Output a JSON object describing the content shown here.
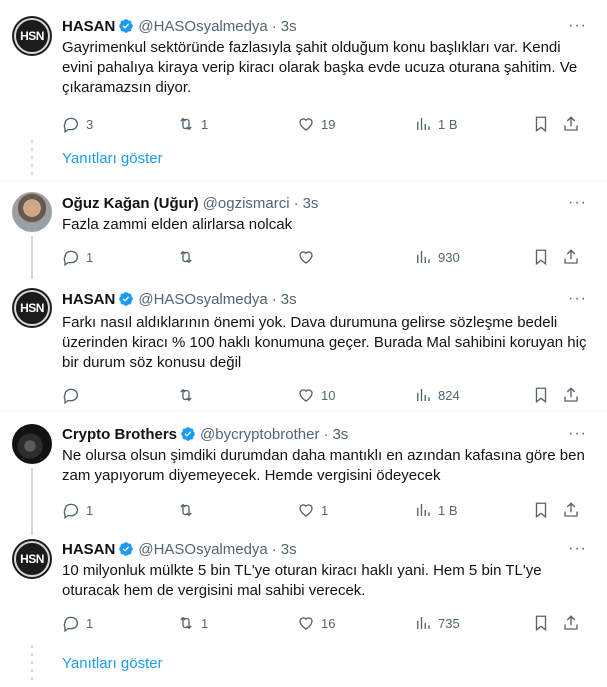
{
  "labels": {
    "show_replies": "Yanıtları göster"
  },
  "colors": {
    "link": "#1d9bf0",
    "verified": "#1d9bf0",
    "text": "#0f1419",
    "muted": "#536471"
  },
  "tweets": [
    {
      "name": "HASAN",
      "verified": true,
      "handle": "@HASOsyalmedya",
      "time": "3s",
      "avatar": "HSN",
      "text": "Gayrimenkul sektöründe fazlasıyla şahit olduğum konu başlıkları var. Kendi evini pahalıya kiraya verip kiracı olarak başka evde ucuza oturana şahitim. Ve çıkaramazsın diyor.",
      "replies": "3",
      "retweets": "1",
      "likes": "19",
      "views": "1 B"
    },
    {
      "name": "Oğuz Kağan (Uğur)",
      "verified": false,
      "handle": "@ogzismarci",
      "time": "3s",
      "text": "Fazla zammi elden alirlarsa nolcak",
      "replies": "1",
      "retweets": "",
      "likes": "",
      "views": "930"
    },
    {
      "name": "HASAN",
      "verified": true,
      "handle": "@HASOsyalmedya",
      "time": "3s",
      "avatar": "HSN",
      "text": "Farkı nasıl aldıklarının önemi yok. Dava durumuna gelirse sözleşme bedeli üzerinden kiracı % 100 haklı konumuna geçer. Burada Mal sahibini koruyan hiç bir durum söz konusu değil",
      "replies": "",
      "retweets": "",
      "likes": "10",
      "views": "824"
    },
    {
      "name": "Crypto Brothers",
      "verified": true,
      "handle": "@bycryptobrother",
      "time": "3s",
      "text": "Ne olursa olsun şimdiki durumdan daha mantıklı en azından kafasına göre ben zam yapıyorum diyemeyecek. Hemde vergisini ödeyecek",
      "replies": "1",
      "retweets": "",
      "likes": "1",
      "views": "1 B"
    },
    {
      "name": "HASAN",
      "verified": true,
      "handle": "@HASOsyalmedya",
      "time": "3s",
      "avatar": "HSN",
      "text": "10 milyonluk mülkte 5 bin TL'ye oturan kiracı haklı yani. Hem 5 bin TL'ye oturacak hem de vergisini mal sahibi verecek.",
      "replies": "1",
      "retweets": "1",
      "likes": "16",
      "views": "735"
    }
  ]
}
